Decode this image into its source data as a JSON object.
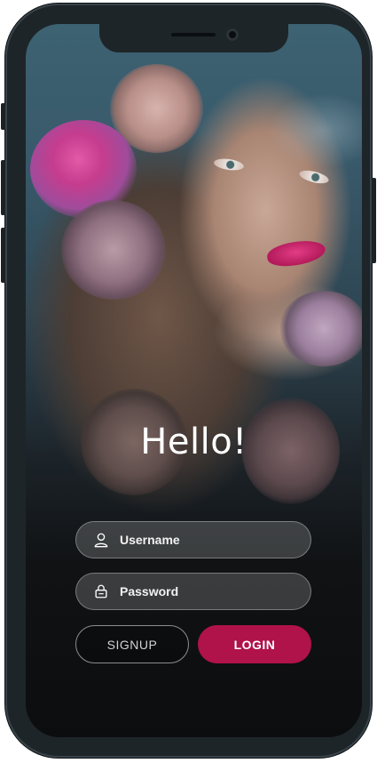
{
  "greeting": "Hello!",
  "form": {
    "username_placeholder": "Username",
    "password_placeholder": "Password",
    "signup_label": "SIGNUP",
    "login_label": "LOGIN"
  },
  "icons": {
    "username": "user-icon",
    "password": "lock-icon"
  },
  "colors": {
    "accent": "#b0124a",
    "field_background": "rgba(255,255,255,0.18)",
    "text": "#ffffff"
  }
}
